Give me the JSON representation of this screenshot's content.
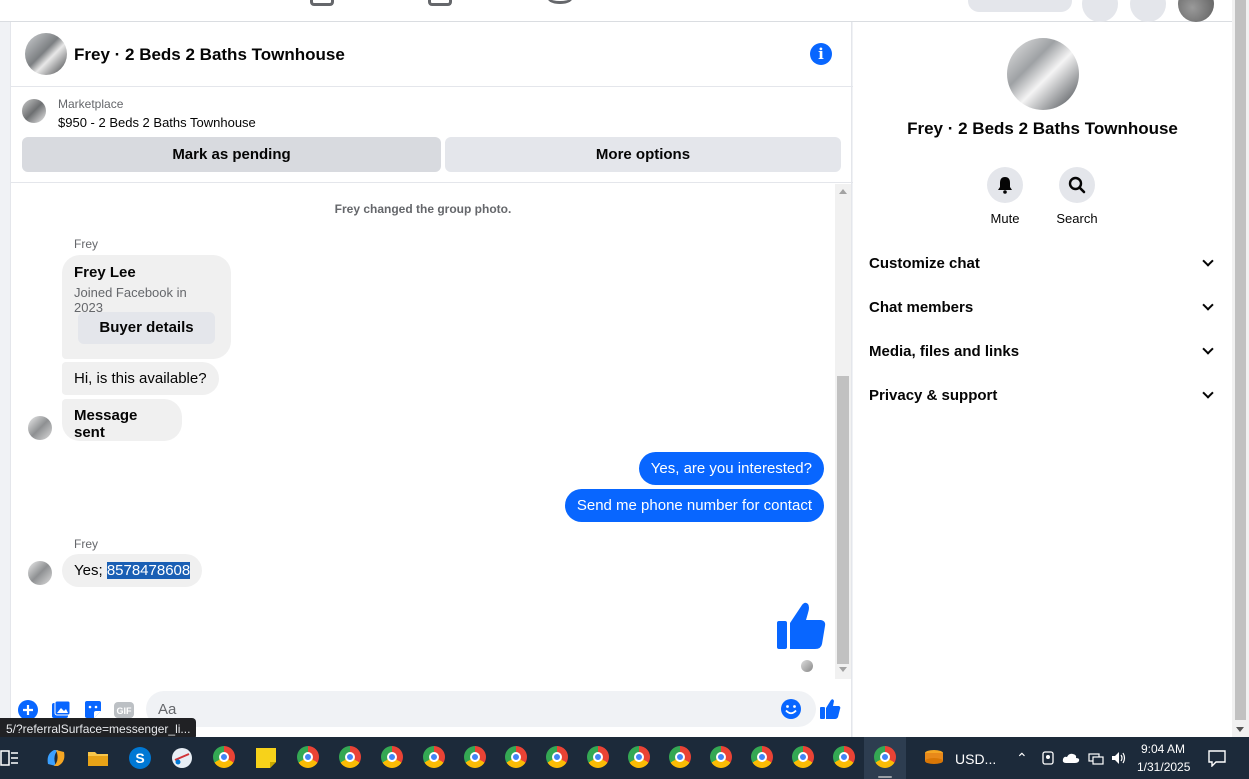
{
  "chat": {
    "title": "Frey · 2 Beds 2 Baths Townhouse",
    "marketplace_label": "Marketplace",
    "listing": "$950 - 2 Beds 2 Baths Townhouse",
    "mark_pending": "Mark as pending",
    "more_options": "More options",
    "system_message": "Frey changed the group photo.",
    "messages": {
      "sender1": "Frey",
      "card_name": "Frey Lee",
      "card_joined": "Joined Facebook in 2023",
      "buyer_details": "Buyer details",
      "msg_available": "Hi, is this available?",
      "msg_sent": "Message sent",
      "out1": "Yes, are you interested?",
      "out2": "Send me phone number for contact",
      "sender2": "Frey",
      "yes_prefix": "Yes; ",
      "yes_number": "8578478608"
    },
    "composer_placeholder": "Aa",
    "status_url": "5/?referralSurface=messenger_li..."
  },
  "details": {
    "title": "Frey · 2 Beds 2 Baths Townhouse",
    "mute": "Mute",
    "search": "Search",
    "sections": [
      "Customize chat",
      "Chat members",
      "Media, files and links",
      "Privacy & support"
    ]
  },
  "taskbar": {
    "currency": "USD...",
    "time": "9:04 AM",
    "date": "1/31/2025"
  },
  "colors": {
    "accent": "#0866ff",
    "bubble_in": "#f0f0f0"
  }
}
